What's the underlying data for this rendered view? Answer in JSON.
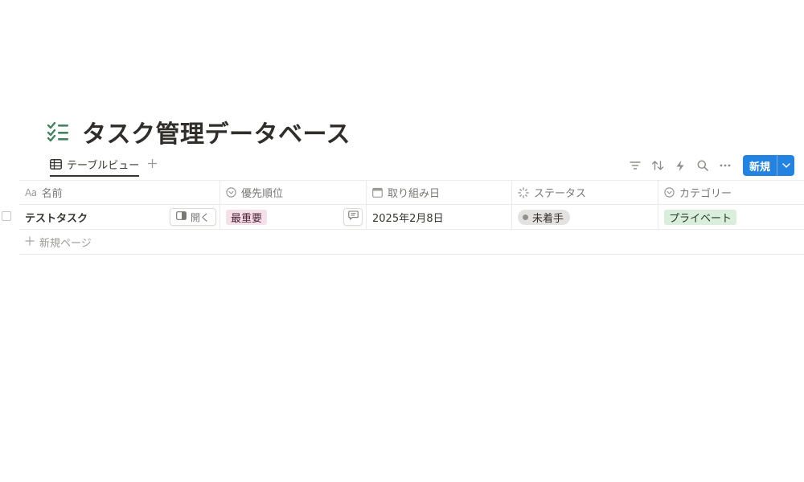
{
  "page": {
    "title": "タスク管理データベース",
    "title_icon": "checklist-icon"
  },
  "view": {
    "tab_label": "テーブルビュー",
    "add_view_icon": "plus-icon"
  },
  "toolbar": {
    "icons": [
      "filter-icon",
      "sort-icon",
      "automation-icon",
      "search-icon",
      "more-icon"
    ],
    "new_label": "新規",
    "accent": "#2383e2"
  },
  "table": {
    "columns": [
      {
        "label": "名前",
        "type_icon": "Aa"
      },
      {
        "label": "優先順位",
        "type_icon": "select-icon"
      },
      {
        "label": "取り組み日",
        "type_icon": "calendar-icon"
      },
      {
        "label": "ステータス",
        "type_icon": "status-icon"
      },
      {
        "label": "カテゴリー",
        "type_icon": "select-icon"
      }
    ],
    "rows": [
      {
        "name": "テストタスク",
        "open_label": "開く",
        "priority": "最重要",
        "date": "2025年2月8日",
        "status": "未着手",
        "category": "プライベート"
      }
    ],
    "add_row_label": "新規ページ"
  },
  "colors": {
    "priority_tag": "#f5e0e9",
    "category_tag": "#dbeddb",
    "status_pill": "#e3e2e0",
    "title_icon": "#448361"
  }
}
